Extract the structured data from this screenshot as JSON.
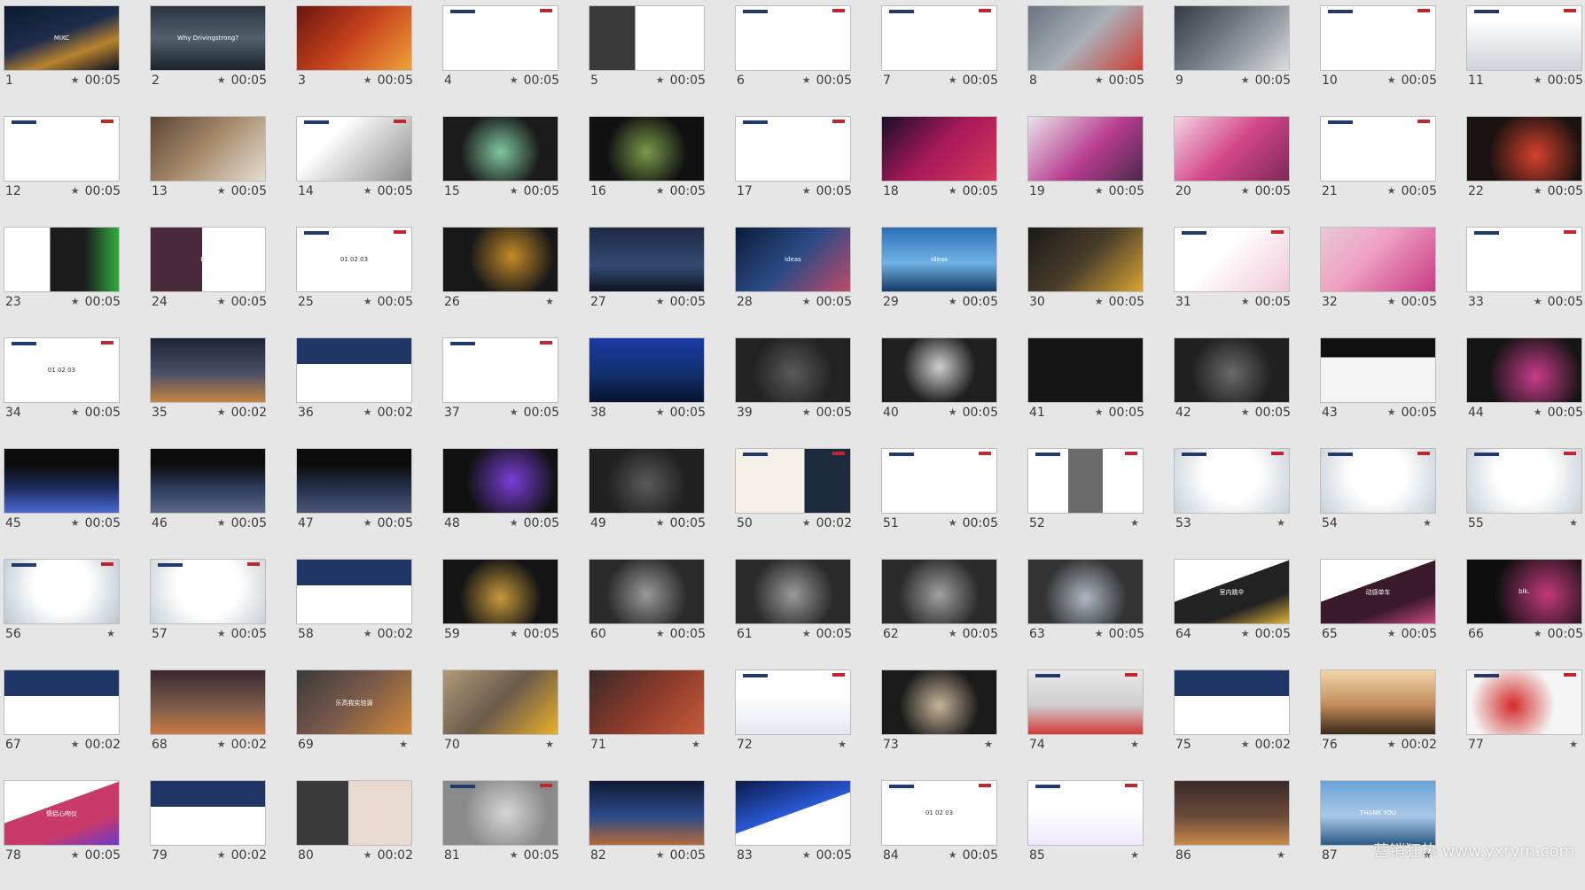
{
  "watermark": "营销狂热 www.yxrym.com",
  "slides": [
    {
      "n": "1",
      "t": "00:05",
      "bg": "linear-gradient(160deg,#0c1930,#1e2d4a 45%,#b8832e 70%,#0b1020)",
      "text": "MIXC"
    },
    {
      "n": "2",
      "t": "00:05",
      "bg": "linear-gradient(180deg,#2b3340,#52606e 50%,#1b222b)",
      "text": "Why Drivingstrong?"
    },
    {
      "n": "3",
      "t": "00:05",
      "bg": "linear-gradient(135deg,#6d1510,#c6421c 50%,#f1a23b)",
      "text": ""
    },
    {
      "n": "4",
      "t": "00:05",
      "bg": "#ffffff",
      "light": true,
      "text": ""
    },
    {
      "n": "5",
      "t": "00:05",
      "bg": "linear-gradient(90deg,#3a3a3a 0 40%,#ffffff 40%)",
      "text": ""
    },
    {
      "n": "6",
      "t": "00:05",
      "bg": "#ffffff",
      "light": true,
      "text": ""
    },
    {
      "n": "7",
      "t": "00:05",
      "bg": "#ffffff",
      "light": true,
      "text": ""
    },
    {
      "n": "8",
      "t": "00:05",
      "bg": "linear-gradient(135deg,#6b7480,#a9b0b8 50%,#cf3d33)",
      "text": ""
    },
    {
      "n": "9",
      "t": "00:05",
      "bg": "linear-gradient(135deg,#333a44,#8c939c 60%,#ddd)",
      "text": ""
    },
    {
      "n": "10",
      "t": "00:05",
      "bg": "#ffffff",
      "light": true,
      "text": ""
    },
    {
      "n": "11",
      "t": "00:05",
      "bg": "linear-gradient(180deg,#ffffff 20%,#cfd3d8)",
      "light": true,
      "text": ""
    },
    {
      "n": "12",
      "t": "00:05",
      "bg": "#ffffff",
      "light": true,
      "text": ""
    },
    {
      "n": "13",
      "t": "00:05",
      "bg": "linear-gradient(135deg,#5b4535,#a88c6d 50%,#e6ddd2)",
      "text": ""
    },
    {
      "n": "14",
      "t": "00:05",
      "bg": "linear-gradient(135deg,#ffffff 30%,#8e8e8e)",
      "light": true,
      "text": ""
    },
    {
      "n": "15",
      "t": "00:05",
      "bg": "radial-gradient(circle at 50% 55%,#7fc8a0,#1a1a1a 60%)",
      "text": ""
    },
    {
      "n": "16",
      "t": "00:05",
      "bg": "radial-gradient(circle at 50% 55%,#7a9a4a,#111 60%)",
      "text": ""
    },
    {
      "n": "17",
      "t": "00:05",
      "bg": "#ffffff",
      "light": true,
      "text": ""
    },
    {
      "n": "18",
      "t": "00:05",
      "bg": "linear-gradient(135deg,#1b0f2a,#a8185a 50%,#d63a5a)",
      "text": ""
    },
    {
      "n": "19",
      "t": "00:05",
      "bg": "linear-gradient(135deg,#e9e2e9,#b83c8f 55%,#4a2a4a)",
      "text": ""
    },
    {
      "n": "20",
      "t": "00:05",
      "bg": "linear-gradient(135deg,#f4d4e4,#d3478a 50%,#7d2855)",
      "text": ""
    },
    {
      "n": "21",
      "t": "00:05",
      "bg": "#ffffff",
      "light": true,
      "text": ""
    },
    {
      "n": "22",
      "t": "00:05",
      "bg": "radial-gradient(circle at 60% 60%,#d6422e,#1a1210 60%)",
      "text": ""
    },
    {
      "n": "23",
      "t": "00:05",
      "bg": "linear-gradient(90deg,#ffffff 40%,#1b1b1b 40% 70%,#2fae3c)",
      "text": ""
    },
    {
      "n": "24",
      "t": "00:05",
      "bg": "linear-gradient(90deg,#4a2a3a 0 45%,#ffffff 45%)",
      "text": "Brief"
    },
    {
      "n": "25",
      "t": "00:05",
      "bg": "#ffffff",
      "light": true,
      "text": "01  02  03"
    },
    {
      "n": "26",
      "t": "",
      "bg": "radial-gradient(circle at 60% 45%,#c48b26,#181818 55%)",
      "text": ""
    },
    {
      "n": "27",
      "t": "00:05",
      "bg": "linear-gradient(180deg,#1f2a44,#324a74 60%,#0e1422)",
      "text": ""
    },
    {
      "n": "28",
      "t": "00:05",
      "bg": "linear-gradient(135deg,#0b1c3a,#2b4b86 50%,#c04a6a)",
      "text": "ideas"
    },
    {
      "n": "29",
      "t": "00:05",
      "bg": "linear-gradient(180deg,#2a6eb8,#6fb2e4 55%,#163a66)",
      "text": "ideas"
    },
    {
      "n": "30",
      "t": "00:05",
      "bg": "linear-gradient(135deg,#1a1a1a,#4a3e2a 50%,#d9a532)",
      "text": ""
    },
    {
      "n": "31",
      "t": "00:05",
      "bg": "linear-gradient(135deg,#ffffff 40%,#f0c7d7)",
      "light": true,
      "text": ""
    },
    {
      "n": "32",
      "t": "00:05",
      "bg": "linear-gradient(135deg,#e7c8d6,#f0a3c2 40%,#c83a86)",
      "text": ""
    },
    {
      "n": "33",
      "t": "00:05",
      "bg": "#ffffff",
      "light": true,
      "text": ""
    },
    {
      "n": "34",
      "t": "00:05",
      "bg": "#ffffff",
      "light": true,
      "text": "01  02  03"
    },
    {
      "n": "35",
      "t": "00:02",
      "bg": "linear-gradient(180deg,#1c2438,#4b4f68 55%,#c28543)",
      "text": ""
    },
    {
      "n": "36",
      "t": "00:02",
      "bg": "linear-gradient(180deg,#1f3566 40%,#ffffff 40%)",
      "text": ""
    },
    {
      "n": "37",
      "t": "00:05",
      "bg": "#ffffff",
      "light": true,
      "text": ""
    },
    {
      "n": "38",
      "t": "00:05",
      "bg": "linear-gradient(180deg,#1a3aa8,#10306e 55%,#0a1430)",
      "text": ""
    },
    {
      "n": "39",
      "t": "00:05",
      "bg": "radial-gradient(circle at 50% 55%,#5a5a5a,#222 60%)",
      "text": ""
    },
    {
      "n": "40",
      "t": "00:05",
      "bg": "radial-gradient(circle at 50% 45%,#cfcfcf,#1f1f1f 55%)",
      "text": ""
    },
    {
      "n": "41",
      "t": "00:05",
      "bg": "#161616",
      "text": ""
    },
    {
      "n": "42",
      "t": "00:05",
      "bg": "radial-gradient(circle at 50% 55%,#6a6a6a,#202020 60%)",
      "text": ""
    },
    {
      "n": "43",
      "t": "00:05",
      "bg": "linear-gradient(180deg,#111 30%,#f5f5f5 30%)",
      "text": ""
    },
    {
      "n": "44",
      "t": "00:05",
      "bg": "radial-gradient(circle at 60% 60%,#c93c8c,#141414 60%)",
      "text": ""
    },
    {
      "n": "45",
      "t": "00:05",
      "bg": "linear-gradient(180deg,#0c0c0c 25%,#1b2a5a 60%,#4a6ad0)",
      "text": ""
    },
    {
      "n": "46",
      "t": "00:05",
      "bg": "linear-gradient(180deg,#0c0c0c 25%,#2b3b5a 60%,#5a6a86)",
      "text": ""
    },
    {
      "n": "47",
      "t": "00:05",
      "bg": "linear-gradient(180deg,#0c0c0c 25%,#22304a 60%,#4a5676)",
      "text": ""
    },
    {
      "n": "48",
      "t": "00:05",
      "bg": "radial-gradient(circle at 60% 50%,#7b3ed8,#111 60%)",
      "text": ""
    },
    {
      "n": "49",
      "t": "00:05",
      "bg": "radial-gradient(circle at 50% 55%,#5a5a5a,#202020 60%)",
      "text": ""
    },
    {
      "n": "50",
      "t": "00:02",
      "bg": "linear-gradient(90deg,#f6f1e8 60%,#1c2b3c 60%)",
      "light": true,
      "text": ""
    },
    {
      "n": "51",
      "t": "00:05",
      "bg": "#ffffff",
      "light": true,
      "text": ""
    },
    {
      "n": "52",
      "t": "",
      "bg": "linear-gradient(90deg,#ffffff 35%,#6b6b6b 35% 65%,#ffffff 65%)",
      "light": true,
      "text": ""
    },
    {
      "n": "53",
      "t": "",
      "bg": "radial-gradient(circle at 50% 40%,#ffffff 40%,#c7cfd6)",
      "light": true,
      "text": ""
    },
    {
      "n": "54",
      "t": "",
      "bg": "radial-gradient(circle at 50% 40%,#ffffff 40%,#c7cfd6)",
      "light": true,
      "text": ""
    },
    {
      "n": "55",
      "t": "",
      "bg": "radial-gradient(circle at 50% 40%,#ffffff 40%,#c7cfd6)",
      "light": true,
      "text": ""
    },
    {
      "n": "56",
      "t": "",
      "bg": "radial-gradient(circle at 50% 40%,#ffffff 40%,#bcc6cf)",
      "light": true,
      "text": ""
    },
    {
      "n": "57",
      "t": "00:05",
      "bg": "radial-gradient(circle at 50% 40%,#ffffff 45%,#c9d0d6)",
      "light": true,
      "text": ""
    },
    {
      "n": "58",
      "t": "00:02",
      "bg": "linear-gradient(180deg,#1f3566 40%,#ffffff 40%)",
      "text": ""
    },
    {
      "n": "59",
      "t": "00:05",
      "bg": "radial-gradient(circle at 50% 60%,#c89a3a,#141414 60%)",
      "text": ""
    },
    {
      "n": "60",
      "t": "00:05",
      "bg": "radial-gradient(circle at 50% 55%,#9a9a9a,#2b2b2b 60%)",
      "text": ""
    },
    {
      "n": "61",
      "t": "00:05",
      "bg": "radial-gradient(circle at 50% 55%,#9a9a9a,#2b2b2b 60%)",
      "text": ""
    },
    {
      "n": "62",
      "t": "00:05",
      "bg": "radial-gradient(circle at 50% 55%,#a0a0a0,#2b2b2b 60%)",
      "text": ""
    },
    {
      "n": "63",
      "t": "00:05",
      "bg": "radial-gradient(circle at 50% 60%,#b0b8c4,#333 60%)",
      "text": ""
    },
    {
      "n": "64",
      "t": "00:05",
      "bg": "linear-gradient(160deg,#ffffff 40%,#222 40% 70%,#e0b23a)",
      "text": "室内跳伞"
    },
    {
      "n": "65",
      "t": "00:05",
      "bg": "linear-gradient(160deg,#ffffff 40%,#3a1a2a 40% 70%,#c84a7a)",
      "text": "动感单车"
    },
    {
      "n": "66",
      "t": "00:05",
      "bg": "radial-gradient(circle at 70% 55%,#c23a7a,#0f0f0f 60%)",
      "text": "blk."
    },
    {
      "n": "67",
      "t": "00:02",
      "bg": "linear-gradient(180deg,#1f3566 40%,#ffffff 40%)",
      "text": ""
    },
    {
      "n": "68",
      "t": "00:02",
      "bg": "linear-gradient(180deg,#3a2830,#7a5a4a 55%,#c97a42)",
      "text": ""
    },
    {
      "n": "69",
      "t": "",
      "bg": "linear-gradient(135deg,#3a3a3a,#7a5a4a 50%,#d28a3a)",
      "text": "乐高我实验源"
    },
    {
      "n": "70",
      "t": "",
      "bg": "linear-gradient(135deg,#b09a7a,#6a5a4a 50%,#e8b02a)",
      "text": ""
    },
    {
      "n": "71",
      "t": "",
      "bg": "linear-gradient(135deg,#3a2a2a,#8a3a2a 50%,#c85a3a)",
      "text": ""
    },
    {
      "n": "72",
      "t": "",
      "bg": "linear-gradient(180deg,#ffffff 40%,#e6e8f0)",
      "light": true,
      "text": ""
    },
    {
      "n": "73",
      "t": "",
      "bg": "radial-gradient(circle at 50% 55%,#c8b49a,#1a1a1a 60%)",
      "text": ""
    },
    {
      "n": "74",
      "t": "",
      "bg": "linear-gradient(180deg,#e8e8e8,#cfcfcf 55%,#d23a3a)",
      "light": true,
      "text": ""
    },
    {
      "n": "75",
      "t": "00:02",
      "bg": "linear-gradient(180deg,#1f3566 40%,#ffffff 40%)",
      "text": ""
    },
    {
      "n": "76",
      "t": "00:02",
      "bg": "linear-gradient(180deg,#f1d6a8,#c28a5a 55%,#3a2a1a)",
      "text": ""
    },
    {
      "n": "77",
      "t": "",
      "bg": "radial-gradient(circle at 40% 55%,#d42a2a,#f5f5f5 55%)",
      "light": true,
      "text": ""
    },
    {
      "n": "78",
      "t": "00:05",
      "bg": "linear-gradient(160deg,#ffffff 40%,#c83a6a 40% 70%,#6a3ac8)",
      "text": "情侣心吻仪"
    },
    {
      "n": "79",
      "t": "00:02",
      "bg": "linear-gradient(180deg,#1f3566 40%,#ffffff 40%)",
      "text": ""
    },
    {
      "n": "80",
      "t": "00:02",
      "bg": "linear-gradient(90deg,#3a3a3a 0 45%,#e9d9cf 45%)",
      "text": ""
    },
    {
      "n": "81",
      "t": "00:05",
      "bg": "radial-gradient(circle at 55% 50%,#d6d6d6,#8a8a8a 60%)",
      "light": true,
      "text": ""
    },
    {
      "n": "82",
      "t": "00:05",
      "bg": "linear-gradient(180deg,#0f1a36,#2b4a8a 55%,#b46a3a)",
      "text": ""
    },
    {
      "n": "83",
      "t": "00:05",
      "bg": "linear-gradient(160deg,#0b1a4a,#2a5ad8 50%,#ffffff 50%)",
      "text": ""
    },
    {
      "n": "84",
      "t": "00:05",
      "bg": "#ffffff",
      "light": true,
      "text": "01  02  03"
    },
    {
      "n": "85",
      "t": "",
      "bg": "linear-gradient(180deg,#ffffff 45%,#f0e7ff)",
      "light": true,
      "text": ""
    },
    {
      "n": "86",
      "t": "",
      "bg": "linear-gradient(180deg,#3a2a2a,#6a4a3a 55%,#c88a4a)",
      "text": ""
    },
    {
      "n": "87",
      "t": "",
      "bg": "linear-gradient(180deg,#6aa3d8,#a9c8e6 55%,#2a5a86)",
      "text": "THANK YOU"
    }
  ]
}
